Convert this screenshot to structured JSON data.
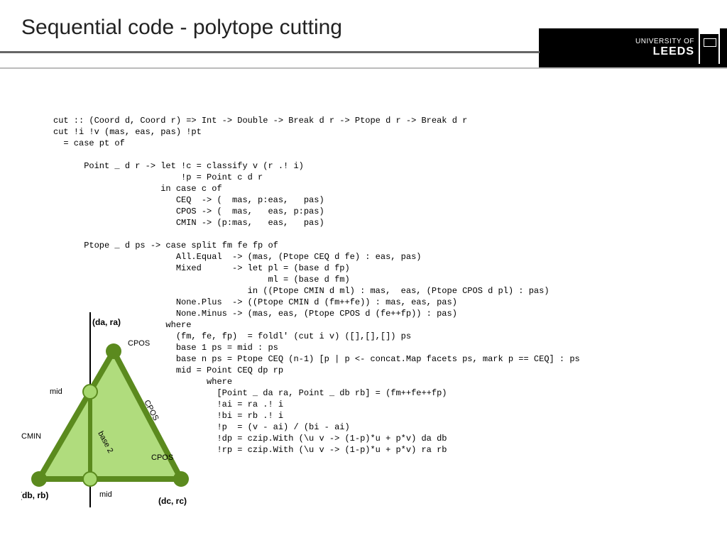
{
  "title": "Sequential code - polytope cutting",
  "logo": {
    "line1": "UNIVERSITY OF",
    "line2": "LEEDS"
  },
  "code": "cut :: (Coord d, Coord r) => Int -> Double -> Break d r -> Ptope d r -> Break d r\ncut !i !v (mas, eas, pas) !pt\n  = case pt of\n\n      Point _ d r -> let !c = classify v (r .! i)\n                         !p = Point c d r\n                     in case c of\n                        CEQ  -> (  mas, p:eas,   pas)\n                        CPOS -> (  mas,   eas, p:pas)\n                        CMIN -> (p:mas,   eas,   pas)\n\n      Ptope _ d ps -> case split fm fe fp of\n                        All.Equal  -> (mas, (Ptope CEQ d fe) : eas, pas)\n                        Mixed      -> let pl = (base d fp)\n                                          ml = (base d fm)\n                                      in ((Ptope CMIN d ml) : mas,  eas, (Ptope CPOS d pl) : pas)\n                        None.Plus  -> ((Ptope CMIN d (fm++fe)) : mas, eas, pas)\n                        None.Minus -> (mas, eas, (Ptope CPOS d (fe++fp)) : pas)\n                      where\n                        (fm, fe, fp)  = foldl' (cut i v) ([],[],[]) ps\n                        base 1 ps = mid : ps\n                        base n ps = Ptope CEQ (n-1) [p | p <- concat.Map facets ps, mark p == CEQ] : ps\n                        mid = Point CEQ dp rp\n                              where\n                                [Point _ da ra, Point _ db rb] = (fm++fe++fp)\n                                !ai = ra .! i\n                                !bi = rb .! i\n                                !p  = (v - ai) / (bi - ai)\n                                !dp = czip.With (\\u v -> (1-p)*u + p*v) da db\n                                !rp = czip.With (\\u v -> (1-p)*u + p*v) ra rb",
  "diagram": {
    "da_ra": "(da, ra)",
    "db_rb": "(db, rb)",
    "dc_rc": "(dc, rc)",
    "cpos": "CPOS",
    "cmin": "CMIN",
    "mid": "mid",
    "base2": "base 2"
  }
}
